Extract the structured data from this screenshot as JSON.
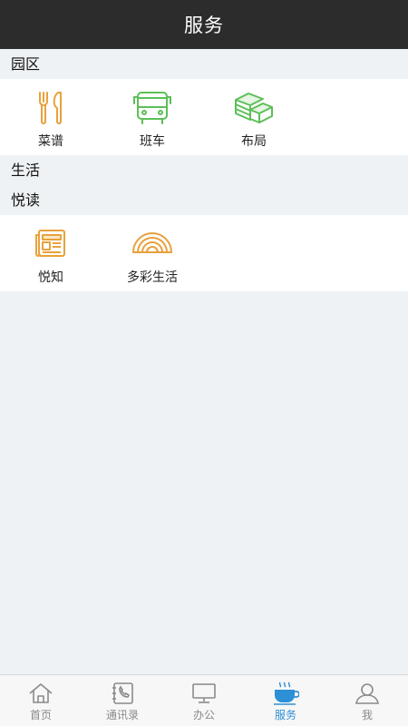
{
  "header": {
    "title": "服务"
  },
  "sections": [
    {
      "title": "园区",
      "items": [
        {
          "label": "菜谱",
          "icon": "fork-knife-icon"
        },
        {
          "label": "班车",
          "icon": "bus-icon"
        },
        {
          "label": "布局",
          "icon": "money-stack-icon"
        }
      ]
    },
    {
      "title": "生活",
      "items": []
    },
    {
      "title": "悦读",
      "items": [
        {
          "label": "悦知",
          "icon": "newspaper-icon"
        },
        {
          "label": "多彩生活",
          "icon": "rainbow-icon"
        }
      ]
    }
  ],
  "tabbar": {
    "items": [
      {
        "label": "首页",
        "icon": "home-icon"
      },
      {
        "label": "通讯录",
        "icon": "contacts-icon"
      },
      {
        "label": "办公",
        "icon": "monitor-icon"
      },
      {
        "label": "服务",
        "icon": "coffee-cup-icon",
        "active": true
      },
      {
        "label": "我",
        "icon": "user-icon"
      }
    ]
  },
  "colors": {
    "header_bg": "#2c2c2c",
    "orange": "#e8a13b",
    "green": "#5cbf57",
    "active_blue": "#2d8fd5"
  }
}
